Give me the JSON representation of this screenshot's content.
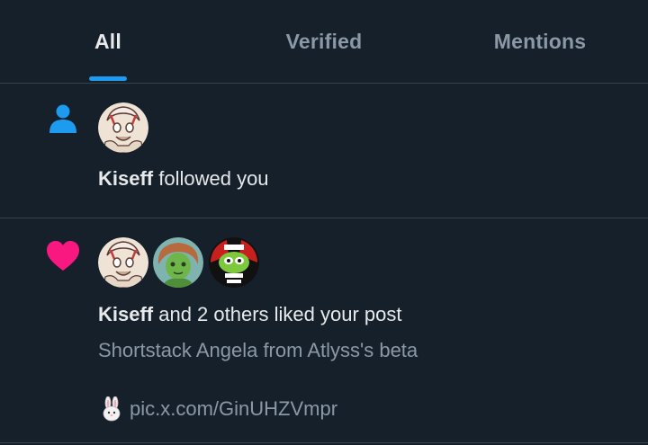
{
  "tabs": [
    {
      "label": "All",
      "active": true
    },
    {
      "label": "Verified",
      "active": false
    },
    {
      "label": "Mentions",
      "active": false
    }
  ],
  "notifications": [
    {
      "type_icon": "person-icon",
      "type_color": "#1d9bf0",
      "avatars": [
        "avatar-kiseff"
      ],
      "actor": "Kiseff",
      "action": " followed you"
    },
    {
      "type_icon": "heart-icon",
      "type_color": "#f91880",
      "avatars": [
        "avatar-kiseff",
        "avatar-green-character",
        "avatar-green-mask"
      ],
      "actor": "Kiseff",
      "action": " and 2 others liked your post",
      "post_text": "Shortstack Angela from Atlyss's beta",
      "post_emoji": "rabbit-face-icon",
      "post_link": "pic.x.com/GinUHZVmpr"
    }
  ],
  "colors": {
    "background": "#15202b",
    "divider": "#38444d",
    "accent": "#1d9bf0",
    "like": "#f91880",
    "secondary_text": "#8b98a5"
  }
}
